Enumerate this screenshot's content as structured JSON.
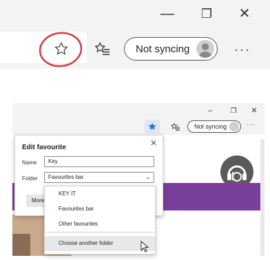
{
  "top_panel": {
    "window_controls": {
      "minimize": "—",
      "restore": "❐",
      "close": "✕"
    },
    "favourites_icon": "star-outline-icon",
    "favourites_list_icon": "favorites-list-icon",
    "sync_label": "Not syncing",
    "more_label": "···",
    "annotation_color": "#d9363e"
  },
  "bottom_panel": {
    "window_controls": {
      "minimize": "–",
      "restore": "❐",
      "close": "✕"
    },
    "star_color": "#2a6fdb",
    "sync_label": "Not syncing",
    "more_label": "···",
    "edit_favourite": {
      "title": "Edit favourite",
      "name_label": "Name",
      "name_value": "Key",
      "folder_label": "Folder",
      "folder_value": "Favourites bar",
      "more_button": "More"
    },
    "folder_dropdown": {
      "items": [
        "KEY IT",
        "Favourites bar",
        "Other favourites"
      ],
      "footer": "Choose another folder"
    },
    "site_logo_icon": "headphones-b-logo-icon",
    "banner_color": "#7a3e9d"
  }
}
